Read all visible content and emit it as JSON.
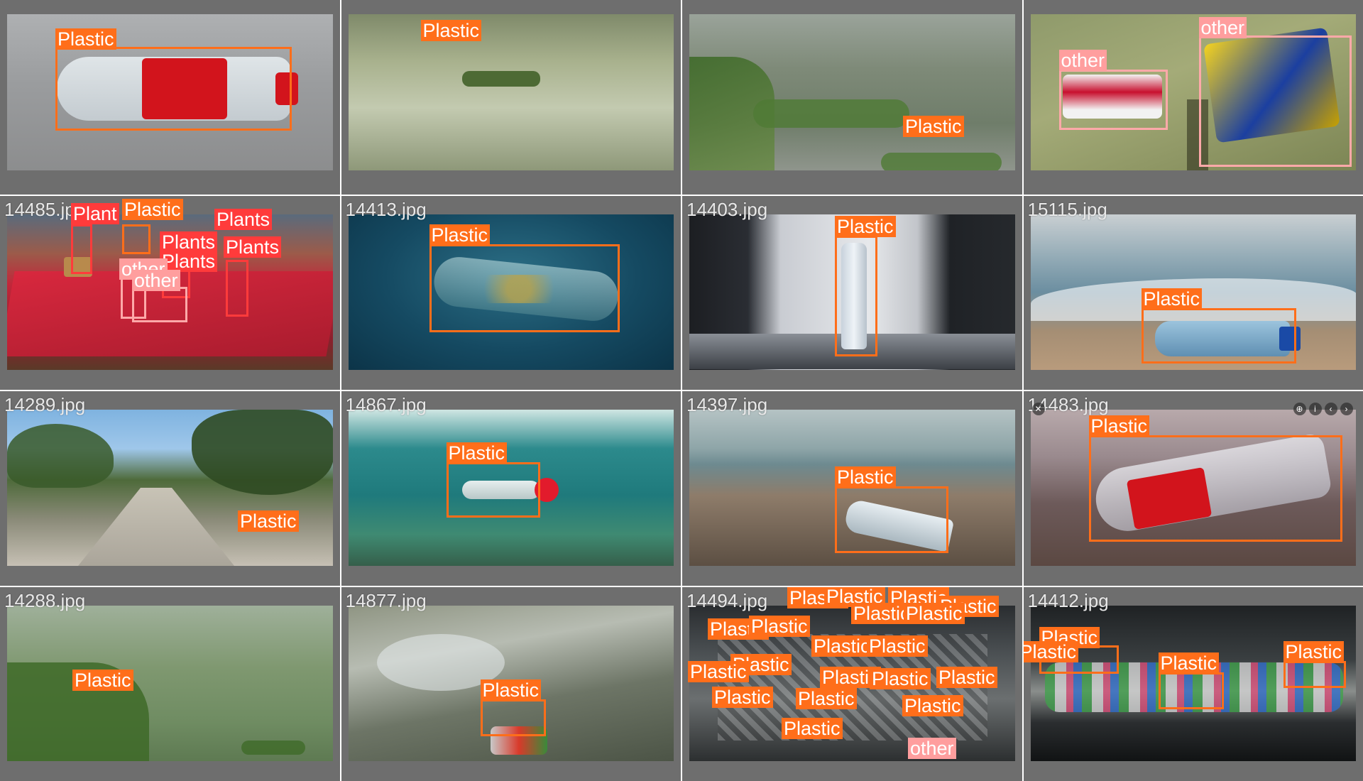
{
  "colors": {
    "plastic": "#ff6e1a",
    "plants": "#ff3b3b",
    "other": "#ff9e9e",
    "tile_frame": "#6e6e6e"
  },
  "tiles": [
    {
      "filename": "",
      "labels": [
        "Plastic"
      ]
    },
    {
      "filename": "",
      "labels": [
        "Plastic"
      ]
    },
    {
      "filename": "",
      "labels": [
        "Plastic"
      ]
    },
    {
      "filename": "",
      "labels": [
        "other",
        "other"
      ]
    },
    {
      "filename": "14485.jpg",
      "labels": [
        "Plant",
        "Plastic",
        "Plants",
        "Plants",
        "Plants",
        "Plants",
        "other",
        "other"
      ]
    },
    {
      "filename": "14413.jpg",
      "labels": [
        "Plastic"
      ]
    },
    {
      "filename": "14403.jpg",
      "labels": [
        "Plastic"
      ]
    },
    {
      "filename": "15115.jpg",
      "labels": [
        "Plastic"
      ]
    },
    {
      "filename": "14289.jpg",
      "labels": [
        "Plastic"
      ]
    },
    {
      "filename": "14867.jpg",
      "labels": [
        "Plastic"
      ]
    },
    {
      "filename": "14397.jpg",
      "labels": [
        "Plastic"
      ]
    },
    {
      "filename": "14483.jpg",
      "labels": [
        "Plastic"
      ]
    },
    {
      "filename": "14288.jpg",
      "labels": [
        "Plastic"
      ]
    },
    {
      "filename": "14877.jpg",
      "labels": [
        "Plastic"
      ]
    },
    {
      "filename": "14494.jpg",
      "labels": [
        "Plastic",
        "Plastic",
        "Plastic",
        "Plastic",
        "Plastic",
        "Plastic",
        "Plastic",
        "Plastic",
        "Plastic",
        "Plastic",
        "Plastic",
        "Plastic",
        "Plastic",
        "Plastic",
        "Plastic",
        "Plastic",
        "Plastic",
        "Plastic",
        "Plastic",
        "other"
      ]
    },
    {
      "filename": "14412.jpg",
      "labels": [
        "Plastic",
        "Plastic",
        "Plastic",
        "Plastic"
      ]
    }
  ]
}
